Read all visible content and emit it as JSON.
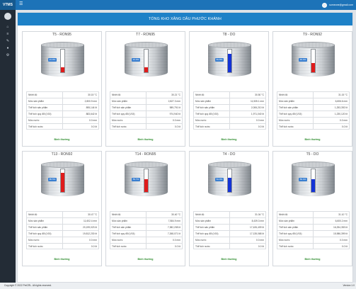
{
  "app": {
    "brand": "VTMS",
    "user": "someone@gmail.com"
  },
  "sidebar": {
    "icons": [
      "home-icon",
      "layers-icon",
      "tools-icon",
      "user-icon",
      "settings-icon"
    ]
  },
  "header": {
    "title": "TỔNG KHO XĂNG DẦU PHƯỚC KHÁNH"
  },
  "labels": {
    "temp": "Nhiệt độ",
    "level": "Mức sản phẩm",
    "vol": "Thể tích sản phẩm",
    "vol15": "Thể tích quy đổi (V15)",
    "water": "Mức nước",
    "watervol": "Thể tích nước",
    "status": "Bình thường"
  },
  "tanks": [
    {
      "name": "T5 - RON95",
      "pct_label": "21.9%",
      "fill": 0.219,
      "color": "#e01b1b",
      "temp": "30.15 °C",
      "level": "2,800.9 mm",
      "vol": "895,144 lít",
      "vol15": "883,642 lít",
      "water": "0.0 mm",
      "watervol": "0.0 lít"
    },
    {
      "name": "T7 - RON95",
      "pct_label": "21.0%",
      "fill": 0.21,
      "color": "#e01b1b",
      "temp": "30.21 °C",
      "level": "2,827.3 mm",
      "vol": "989,791 lít",
      "vol15": "974,940 lít",
      "water": "0.0 mm",
      "watervol": "0.0 lít"
    },
    {
      "name": "T8 - DO",
      "pct_label": "81.8%",
      "fill": 0.818,
      "color": "#1433d6",
      "temp": "30.50 °C",
      "level": "11,535.1 mm",
      "vol": "2,006,210 lít",
      "vol15": "1,971,040 lít",
      "water": "0.0 mm",
      "watervol": "0.0 lít"
    },
    {
      "name": "T9 - RON92",
      "pct_label": "40.4%",
      "fill": 0.404,
      "color": "#e01b1b",
      "temp": "31.15 °C",
      "level": "6,606.6 mm",
      "vol": "1,253,392 lít",
      "vol15": "1,230,120 lít",
      "water": "0.0 mm",
      "watervol": "0.0 lít"
    },
    {
      "name": "T13 - RON92",
      "pct_label": "85.5%",
      "fill": 0.855,
      "color": "#e01b1b",
      "temp": "30.47 °C",
      "level": "11,602.4 mm",
      "vol": "20,199,023 lít",
      "vol15": "19,812,230 lít",
      "water": "0.0 mm",
      "watervol": "0.0 lít"
    },
    {
      "name": "T14 - RON95",
      "pct_label": "55.7%",
      "fill": 0.557,
      "color": "#e01b1b",
      "temp": "30.40 °C",
      "level": "7,584.9 mm",
      "vol": "7,382,208 lít",
      "vol15": "7,268,071 lít",
      "water": "0.0 mm",
      "watervol": "0.0 lít"
    },
    {
      "name": "T4 - DO",
      "pct_label": "61.9%",
      "fill": 0.619,
      "color": "#1433d6",
      "temp": "31.04 °C",
      "level": "8,439.3 mm",
      "vol": "17,426,409 lít",
      "vol15": "17,135,068 lít",
      "water": "0.0 mm",
      "watervol": "0.0 lít"
    },
    {
      "name": "T5 - DO",
      "pct_label": "56.4%",
      "fill": 0.564,
      "color": "#1433d6",
      "temp": "31.10 °C",
      "level": "6,600.2 mm",
      "vol": "16,254,353 lít",
      "vol15": "15,986,399 lít",
      "water": "0.0 mm",
      "watervol": "0.0 lít"
    }
  ],
  "footer": {
    "copyright": "Copyright © 2022 PetCRL. All rights reserved.",
    "version": "Version 1.0"
  }
}
